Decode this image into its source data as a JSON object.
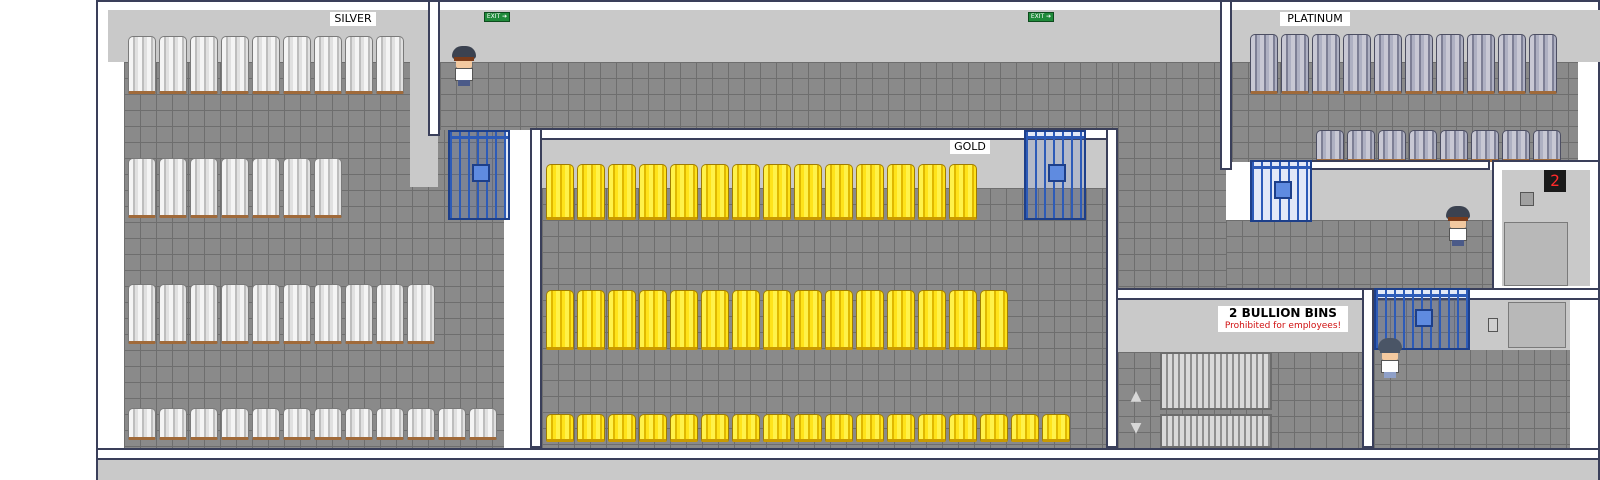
{
  "rooms": {
    "silver": {
      "label": "SILVER"
    },
    "gold": {
      "label": "GOLD"
    },
    "platinum": {
      "label": "PLATINUM"
    }
  },
  "exits": [
    "EXIT ➔",
    "EXIT ➔"
  ],
  "bins_sign": {
    "title": "2  BULLION BINS",
    "subtitle": "Prohibited for employees!"
  },
  "elevator": {
    "floor": "2"
  },
  "colors": {
    "floor": "#8a8a8a",
    "wall": "#c9c9c9",
    "gate": "#2d5bb8",
    "gold": "#ffe31a",
    "silver": "#e0e0e0",
    "platinum": "#aeb0c2",
    "floor_display": "#ff2a2a"
  },
  "icons": {
    "stairs_up": "▲",
    "stairs_down": "▼"
  }
}
